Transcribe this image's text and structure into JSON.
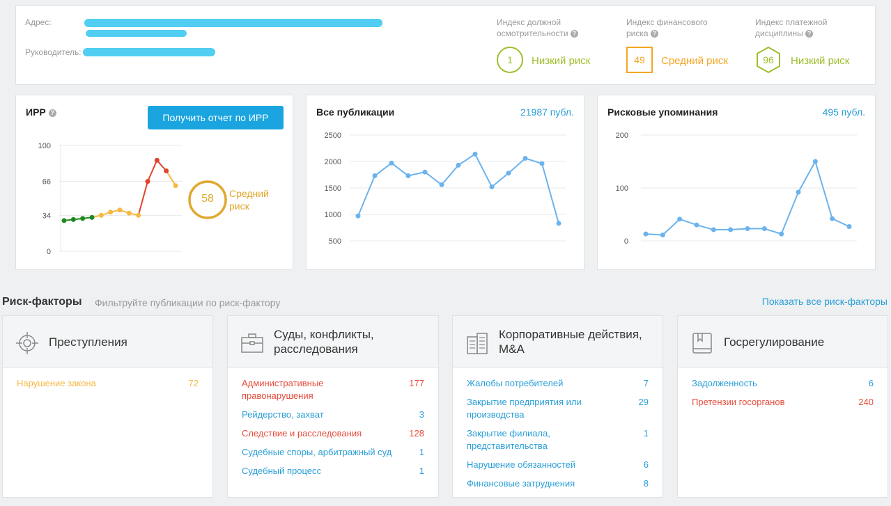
{
  "header": {
    "address_label": "Адрес:",
    "manager_label": "Руководитель:"
  },
  "indices": [
    {
      "title": "Индекс должной осмотрительности",
      "value": "1",
      "risk": "Низкий риск",
      "color": "#9cbf2b",
      "shape": "circle"
    },
    {
      "title": "Индекс финансового риска",
      "value": "49",
      "risk": "Средний риск",
      "color": "#f5a623",
      "shape": "square"
    },
    {
      "title": "Индекс платежной дисциплины",
      "value": "96",
      "risk": "Низкий риск",
      "color": "#9cbf2b",
      "shape": "hexagon"
    }
  ],
  "irr": {
    "title": "ИРР",
    "button": "Получить отчет по ИРР",
    "score": "58",
    "risk_line1": "Средний",
    "risk_line2": "риск",
    "score_color": "#e0a82e"
  },
  "publications": {
    "title": "Все публикации",
    "count": "21987 публ."
  },
  "risk_mentions": {
    "title": "Рисковые упоминания",
    "count": "495 публ."
  },
  "chart_data": [
    {
      "type": "line",
      "title": "ИРР",
      "yticks": [
        "100",
        "66",
        "34",
        "0"
      ],
      "ylim": [
        0,
        100
      ],
      "grid": true,
      "values": [
        29,
        30,
        31,
        32,
        34,
        37,
        39,
        36,
        34,
        66,
        86,
        76,
        62
      ],
      "colors": [
        "#1e8a1e",
        "#1e8a1e",
        "#1e8a1e",
        "#1e8a1e",
        "#f5b942",
        "#f5b942",
        "#f5b942",
        "#f5b942",
        "#f5b942",
        "#e0442c",
        "#e0442c",
        "#e0442c",
        "#f5b942"
      ]
    },
    {
      "type": "line",
      "title": "Все публикации",
      "yticks": [
        "2500",
        "2000",
        "1500",
        "1000",
        "500"
      ],
      "ylim": [
        500,
        2500
      ],
      "grid": true,
      "values": [
        970,
        1730,
        1970,
        1730,
        1800,
        1560,
        1930,
        2140,
        1520,
        1780,
        2060,
        1960,
        830
      ],
      "color": "#6bb3ee"
    },
    {
      "type": "line",
      "title": "Рисковые упоминания",
      "yticks": [
        "200",
        "100",
        "0"
      ],
      "ylim": [
        0,
        200
      ],
      "grid": true,
      "values": [
        13,
        11,
        41,
        30,
        21,
        21,
        23,
        23,
        13,
        92,
        150,
        42,
        27
      ],
      "color": "#6bb3ee"
    }
  ],
  "risk_factors": {
    "title": "Риск-факторы",
    "subtitle": "Фильтруйте публикации по риск-фактору",
    "show_all": "Показать все риск-факторы",
    "categories": [
      {
        "name": "Преступления",
        "icon": "crosshair-icon",
        "items": [
          {
            "label": "Нарушение закона",
            "count": "72",
            "cls": "c-yellow"
          }
        ]
      },
      {
        "name": "Суды, конфликты, расследования",
        "icon": "briefcase-icon",
        "items": [
          {
            "label": "Административные правонарушения",
            "count": "177",
            "cls": "c-red"
          },
          {
            "label": "Рейдерство, захват",
            "count": "3",
            "cls": "c-blue"
          },
          {
            "label": "Следствие и расследования",
            "count": "128",
            "cls": "c-red"
          },
          {
            "label": "Судебные споры, арбитражный суд",
            "count": "1",
            "cls": "c-blue"
          },
          {
            "label": "Судебный процесс",
            "count": "1",
            "cls": "c-blue"
          }
        ]
      },
      {
        "name": "Корпоративные действия, M&A",
        "icon": "building-icon",
        "items": [
          {
            "label": "Жалобы потребителей",
            "count": "7",
            "cls": "c-blue"
          },
          {
            "label": "Закрытие предприятия или производства",
            "count": "29",
            "cls": "c-blue"
          },
          {
            "label": "Закрытие филиала, представительства",
            "count": "1",
            "cls": "c-blue"
          },
          {
            "label": "Нарушение обязанностей",
            "count": "6",
            "cls": "c-blue"
          },
          {
            "label": "Финансовые затруднения",
            "count": "8",
            "cls": "c-blue"
          }
        ]
      },
      {
        "name": "Госрегулирование",
        "icon": "book-icon",
        "items": [
          {
            "label": "Задолженность",
            "count": "6",
            "cls": "c-blue"
          },
          {
            "label": "Претензии госорганов",
            "count": "240",
            "cls": "c-red"
          }
        ]
      }
    ]
  }
}
